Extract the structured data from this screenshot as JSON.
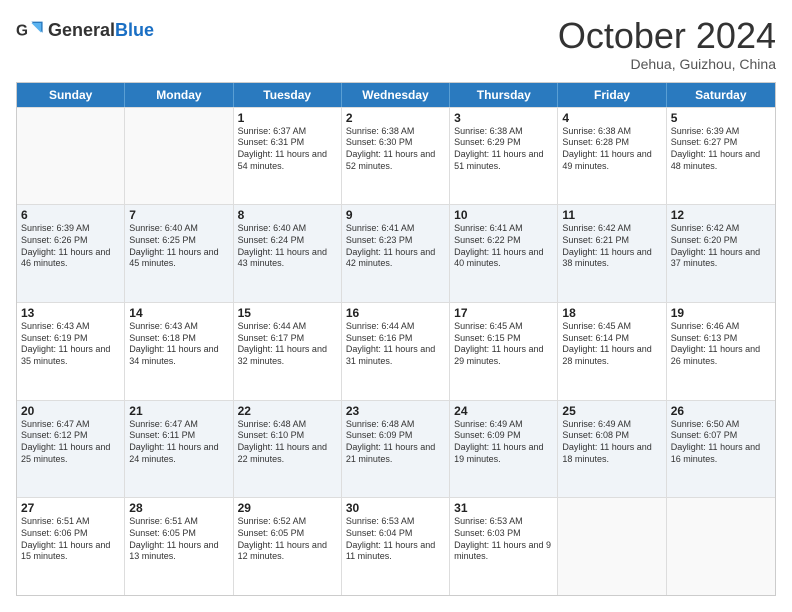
{
  "header": {
    "logo_general": "General",
    "logo_blue": "Blue",
    "month_title": "October 2024",
    "location": "Dehua, Guizhou, China"
  },
  "days_of_week": [
    "Sunday",
    "Monday",
    "Tuesday",
    "Wednesday",
    "Thursday",
    "Friday",
    "Saturday"
  ],
  "weeks": [
    [
      {
        "day": "",
        "sunrise": "",
        "sunset": "",
        "daylight": "",
        "empty": true
      },
      {
        "day": "",
        "sunrise": "",
        "sunset": "",
        "daylight": "",
        "empty": true
      },
      {
        "day": "1",
        "sunrise": "Sunrise: 6:37 AM",
        "sunset": "Sunset: 6:31 PM",
        "daylight": "Daylight: 11 hours and 54 minutes.",
        "empty": false
      },
      {
        "day": "2",
        "sunrise": "Sunrise: 6:38 AM",
        "sunset": "Sunset: 6:30 PM",
        "daylight": "Daylight: 11 hours and 52 minutes.",
        "empty": false
      },
      {
        "day": "3",
        "sunrise": "Sunrise: 6:38 AM",
        "sunset": "Sunset: 6:29 PM",
        "daylight": "Daylight: 11 hours and 51 minutes.",
        "empty": false
      },
      {
        "day": "4",
        "sunrise": "Sunrise: 6:38 AM",
        "sunset": "Sunset: 6:28 PM",
        "daylight": "Daylight: 11 hours and 49 minutes.",
        "empty": false
      },
      {
        "day": "5",
        "sunrise": "Sunrise: 6:39 AM",
        "sunset": "Sunset: 6:27 PM",
        "daylight": "Daylight: 11 hours and 48 minutes.",
        "empty": false
      }
    ],
    [
      {
        "day": "6",
        "sunrise": "Sunrise: 6:39 AM",
        "sunset": "Sunset: 6:26 PM",
        "daylight": "Daylight: 11 hours and 46 minutes.",
        "empty": false
      },
      {
        "day": "7",
        "sunrise": "Sunrise: 6:40 AM",
        "sunset": "Sunset: 6:25 PM",
        "daylight": "Daylight: 11 hours and 45 minutes.",
        "empty": false
      },
      {
        "day": "8",
        "sunrise": "Sunrise: 6:40 AM",
        "sunset": "Sunset: 6:24 PM",
        "daylight": "Daylight: 11 hours and 43 minutes.",
        "empty": false
      },
      {
        "day": "9",
        "sunrise": "Sunrise: 6:41 AM",
        "sunset": "Sunset: 6:23 PM",
        "daylight": "Daylight: 11 hours and 42 minutes.",
        "empty": false
      },
      {
        "day": "10",
        "sunrise": "Sunrise: 6:41 AM",
        "sunset": "Sunset: 6:22 PM",
        "daylight": "Daylight: 11 hours and 40 minutes.",
        "empty": false
      },
      {
        "day": "11",
        "sunrise": "Sunrise: 6:42 AM",
        "sunset": "Sunset: 6:21 PM",
        "daylight": "Daylight: 11 hours and 38 minutes.",
        "empty": false
      },
      {
        "day": "12",
        "sunrise": "Sunrise: 6:42 AM",
        "sunset": "Sunset: 6:20 PM",
        "daylight": "Daylight: 11 hours and 37 minutes.",
        "empty": false
      }
    ],
    [
      {
        "day": "13",
        "sunrise": "Sunrise: 6:43 AM",
        "sunset": "Sunset: 6:19 PM",
        "daylight": "Daylight: 11 hours and 35 minutes.",
        "empty": false
      },
      {
        "day": "14",
        "sunrise": "Sunrise: 6:43 AM",
        "sunset": "Sunset: 6:18 PM",
        "daylight": "Daylight: 11 hours and 34 minutes.",
        "empty": false
      },
      {
        "day": "15",
        "sunrise": "Sunrise: 6:44 AM",
        "sunset": "Sunset: 6:17 PM",
        "daylight": "Daylight: 11 hours and 32 minutes.",
        "empty": false
      },
      {
        "day": "16",
        "sunrise": "Sunrise: 6:44 AM",
        "sunset": "Sunset: 6:16 PM",
        "daylight": "Daylight: 11 hours and 31 minutes.",
        "empty": false
      },
      {
        "day": "17",
        "sunrise": "Sunrise: 6:45 AM",
        "sunset": "Sunset: 6:15 PM",
        "daylight": "Daylight: 11 hours and 29 minutes.",
        "empty": false
      },
      {
        "day": "18",
        "sunrise": "Sunrise: 6:45 AM",
        "sunset": "Sunset: 6:14 PM",
        "daylight": "Daylight: 11 hours and 28 minutes.",
        "empty": false
      },
      {
        "day": "19",
        "sunrise": "Sunrise: 6:46 AM",
        "sunset": "Sunset: 6:13 PM",
        "daylight": "Daylight: 11 hours and 26 minutes.",
        "empty": false
      }
    ],
    [
      {
        "day": "20",
        "sunrise": "Sunrise: 6:47 AM",
        "sunset": "Sunset: 6:12 PM",
        "daylight": "Daylight: 11 hours and 25 minutes.",
        "empty": false
      },
      {
        "day": "21",
        "sunrise": "Sunrise: 6:47 AM",
        "sunset": "Sunset: 6:11 PM",
        "daylight": "Daylight: 11 hours and 24 minutes.",
        "empty": false
      },
      {
        "day": "22",
        "sunrise": "Sunrise: 6:48 AM",
        "sunset": "Sunset: 6:10 PM",
        "daylight": "Daylight: 11 hours and 22 minutes.",
        "empty": false
      },
      {
        "day": "23",
        "sunrise": "Sunrise: 6:48 AM",
        "sunset": "Sunset: 6:09 PM",
        "daylight": "Daylight: 11 hours and 21 minutes.",
        "empty": false
      },
      {
        "day": "24",
        "sunrise": "Sunrise: 6:49 AM",
        "sunset": "Sunset: 6:09 PM",
        "daylight": "Daylight: 11 hours and 19 minutes.",
        "empty": false
      },
      {
        "day": "25",
        "sunrise": "Sunrise: 6:49 AM",
        "sunset": "Sunset: 6:08 PM",
        "daylight": "Daylight: 11 hours and 18 minutes.",
        "empty": false
      },
      {
        "day": "26",
        "sunrise": "Sunrise: 6:50 AM",
        "sunset": "Sunset: 6:07 PM",
        "daylight": "Daylight: 11 hours and 16 minutes.",
        "empty": false
      }
    ],
    [
      {
        "day": "27",
        "sunrise": "Sunrise: 6:51 AM",
        "sunset": "Sunset: 6:06 PM",
        "daylight": "Daylight: 11 hours and 15 minutes.",
        "empty": false
      },
      {
        "day": "28",
        "sunrise": "Sunrise: 6:51 AM",
        "sunset": "Sunset: 6:05 PM",
        "daylight": "Daylight: 11 hours and 13 minutes.",
        "empty": false
      },
      {
        "day": "29",
        "sunrise": "Sunrise: 6:52 AM",
        "sunset": "Sunset: 6:05 PM",
        "daylight": "Daylight: 11 hours and 12 minutes.",
        "empty": false
      },
      {
        "day": "30",
        "sunrise": "Sunrise: 6:53 AM",
        "sunset": "Sunset: 6:04 PM",
        "daylight": "Daylight: 11 hours and 11 minutes.",
        "empty": false
      },
      {
        "day": "31",
        "sunrise": "Sunrise: 6:53 AM",
        "sunset": "Sunset: 6:03 PM",
        "daylight": "Daylight: 11 hours and 9 minutes.",
        "empty": false
      },
      {
        "day": "",
        "sunrise": "",
        "sunset": "",
        "daylight": "",
        "empty": true
      },
      {
        "day": "",
        "sunrise": "",
        "sunset": "",
        "daylight": "",
        "empty": true
      }
    ]
  ]
}
